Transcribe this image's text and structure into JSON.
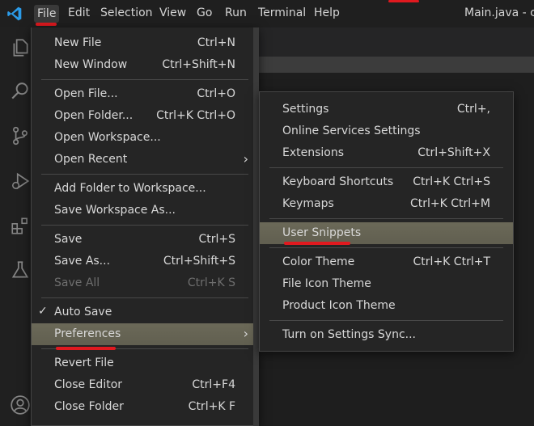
{
  "menubar": {
    "items": [
      "File",
      "Edit",
      "Selection",
      "View",
      "Go",
      "Run",
      "Terminal",
      "Help"
    ],
    "title": "Main.java - cp -"
  },
  "file_menu": {
    "items": [
      {
        "label": "New File",
        "key": "Ctrl+N"
      },
      {
        "label": "New Window",
        "key": "Ctrl+Shift+N"
      },
      {
        "label": "Open File...",
        "key": "Ctrl+O"
      },
      {
        "label": "Open Folder...",
        "key": "Ctrl+K Ctrl+O"
      },
      {
        "label": "Open Workspace...",
        "key": ""
      },
      {
        "label": "Open Recent",
        "key": ""
      },
      {
        "label": "Add Folder to Workspace...",
        "key": ""
      },
      {
        "label": "Save Workspace As...",
        "key": ""
      },
      {
        "label": "Save",
        "key": "Ctrl+S"
      },
      {
        "label": "Save As...",
        "key": "Ctrl+Shift+S"
      },
      {
        "label": "Save All",
        "key": "Ctrl+K S"
      },
      {
        "label": "Auto Save",
        "key": ""
      },
      {
        "label": "Preferences",
        "key": ""
      },
      {
        "label": "Revert File",
        "key": ""
      },
      {
        "label": "Close Editor",
        "key": "Ctrl+F4"
      },
      {
        "label": "Close Folder",
        "key": "Ctrl+K F"
      }
    ]
  },
  "pref_menu": {
    "items": [
      {
        "label": "Settings",
        "key": "Ctrl+,"
      },
      {
        "label": "Online Services Settings",
        "key": ""
      },
      {
        "label": "Extensions",
        "key": "Ctrl+Shift+X"
      },
      {
        "label": "Keyboard Shortcuts",
        "key": "Ctrl+K Ctrl+S"
      },
      {
        "label": "Keymaps",
        "key": "Ctrl+K Ctrl+M"
      },
      {
        "label": "User Snippets",
        "key": ""
      },
      {
        "label": "Color Theme",
        "key": "Ctrl+K Ctrl+T"
      },
      {
        "label": "File Icon Theme",
        "key": ""
      },
      {
        "label": "Product Icon Theme",
        "key": ""
      },
      {
        "label": "Turn on Settings Sync...",
        "key": ""
      }
    ]
  },
  "colors": {
    "accent_red": "#e0191f",
    "highlight": "#615f50",
    "menu_bg": "#252525"
  }
}
